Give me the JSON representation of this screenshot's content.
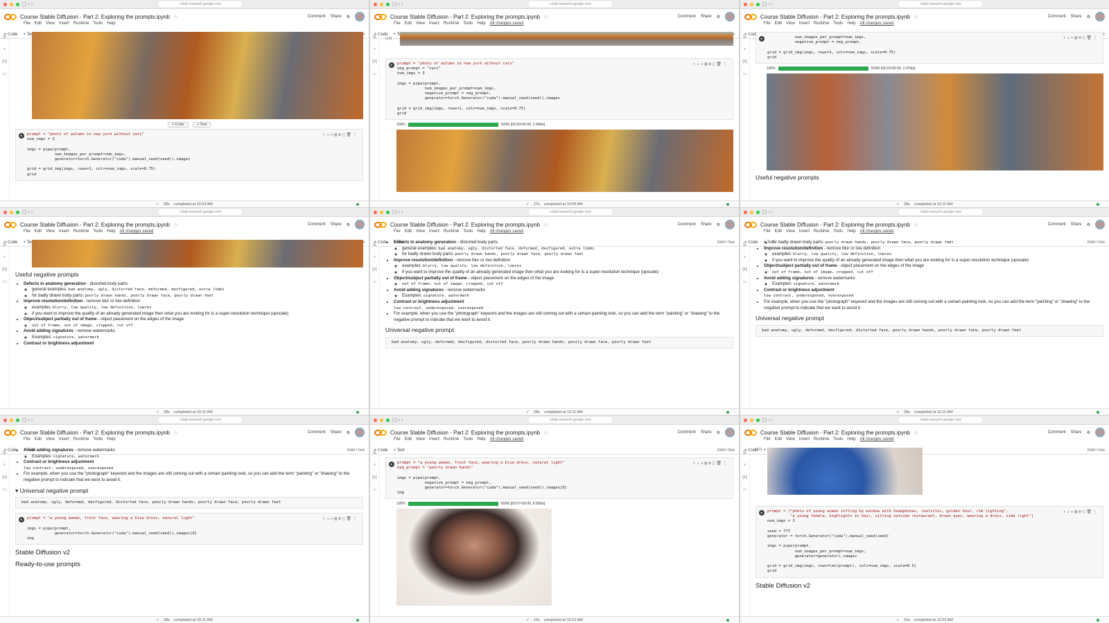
{
  "app": {
    "title": "Course Stable Diffusion - Part 2: Exploring the prompts.ipynb",
    "url": "colab.research.google.com",
    "menu": [
      "File",
      "Edit",
      "View",
      "Insert",
      "Runtime",
      "Tools",
      "Help"
    ],
    "saved": "All changes saved",
    "comment": "Comment",
    "share": "Share",
    "code_btn": "+ Code",
    "text_btn": "+ Text",
    "ram": "RAM / Disk"
  },
  "code": {
    "prompt1": "prompt = \"photo of autumn in new york without cars\"",
    "neg1": "neg_prompt = \"cars\"",
    "num3": "num_imgs = 3",
    "pipe_call": "imgs = pipe(prompt,",
    "arg_num": "            num_images_per_prompt=num_imgs,",
    "arg_neg": "            negative_prompt = neg_prompt,",
    "arg_gen": "            generator=torch.Generator(\"cuda\").manual_seed(seed)).images",
    "grid1": "grid = grid_img(imgs, rows=1, cols=num_imgs, scale=0.75)",
    "grid2": "grid",
    "prompt_woman": "prompt = \"a young woman, front face, wearing a blue dress, natural light\"",
    "neg_woman": "neg_prompt = \"poorly drawn hands\"",
    "pipe_neg": "imgs = pipe(prompt,",
    "neg_arg": "            negative_prompt = neg_prompt,",
    "gen_img0": "            generator=torch.Generator(\"cuda\").manual_seed(seed)).images[0]",
    "imgs": "img",
    "prompt_list1": "prompt = [\"photo of young woman sitting by window with headphones, realistic, golden hour, rim lighting\",",
    "prompt_list2": "          \"a young female, highlights in hair, sitting outside restaurant, brown eyes, wearing a dress, side light\"]",
    "seed": "seed = 777",
    "generator": "generator = torch.Generator(\"cuda\").manual_seed(seed)",
    "pipe_gen": "            generator=generator).images",
    "grid_len": "grid = grid_img(imgs, rows=len(prompt), cols=num_imgs, scale=0.5)",
    "exec19": "[19]",
    "exec32": "[32]"
  },
  "progress": {
    "p1": "100%",
    "p1_info": "50/50 [00:20<00:00, 2.47it/s]",
    "p2": "100%",
    "p2_info": "50/50 [00:20<00:00, 2.49it/s]",
    "p3": "100%",
    "p3_info": "50/50 [00:07<00:00, 6.65it/s]",
    "fraction": 1.0
  },
  "md": {
    "useful_heading": "Useful negative prompts",
    "defects": "Defects in anatomy generation",
    "defects_desc": " - distorted body parts.",
    "general": "general examples: ",
    "general_vals": "bad anatomy, ugly, distorted face, deformed, desfigured, extra limbs",
    "badly": "for badly drawn body parts: ",
    "badly_vals": "poorly drawn hands, poorly drawn face, poorly drawn feet",
    "improve": "Improve resolution/definition",
    "improve_desc": " - remove blur or low definition",
    "examples": "examples: ",
    "improve_vals": "blurry, low quality, low definition, lowres",
    "superres": "if you want to improve the quality of an already generated image then what you are looking for is a super-resolution technique (upscale)",
    "object": "Object/subject partially out of frame",
    "object_desc": " - object placement on the edges of the image",
    "object_vals": "out of frame, out of image, cropped, cut off",
    "avoid": "Avoid adding signatures",
    "avoid_desc": " - remove watermarks",
    "examples2": "Examples: ",
    "avoid_vals": "signature, watermark",
    "contrast": "Contrast or brightness adjustment",
    "contrast_vals": "low contrast, underexposed, overexposed",
    "forexample": "For example, when you use the \"photograph\" keyword and the images are still coming out with a certain painting look, so you can add the term \"painting\" or \"drawing\" to the negative prompt to indicate that we want to avoid it.",
    "universal": "Universal negative prompt",
    "universal_vals": "bad anatomy, ugly, deformed, desfigured, distorted face, poorly drawn hands, poorly drawn face, poorly drawn feet",
    "sdv2": "Stable Diffusion v2",
    "ready": "Ready-to-use prompts"
  },
  "status": [
    {
      "time": "28s",
      "done": "completed at 10:03 AM"
    },
    {
      "time": "27s",
      "done": "completed at 10:05 AM"
    },
    {
      "time": "28s",
      "done": "completed at 10:11 AM"
    },
    {
      "time": "28s",
      "done": "completed at 10:11 AM"
    },
    {
      "time": "28s",
      "done": "completed at 10:11 AM"
    },
    {
      "time": "28s",
      "done": "completed at 10:11 AM"
    },
    {
      "time": "28s",
      "done": "completed at 10:11 AM"
    },
    {
      "time": "10s",
      "done": "completed at 10:22 AM"
    },
    {
      "time": "10s",
      "done": "completed at 10:23 AM"
    }
  ]
}
